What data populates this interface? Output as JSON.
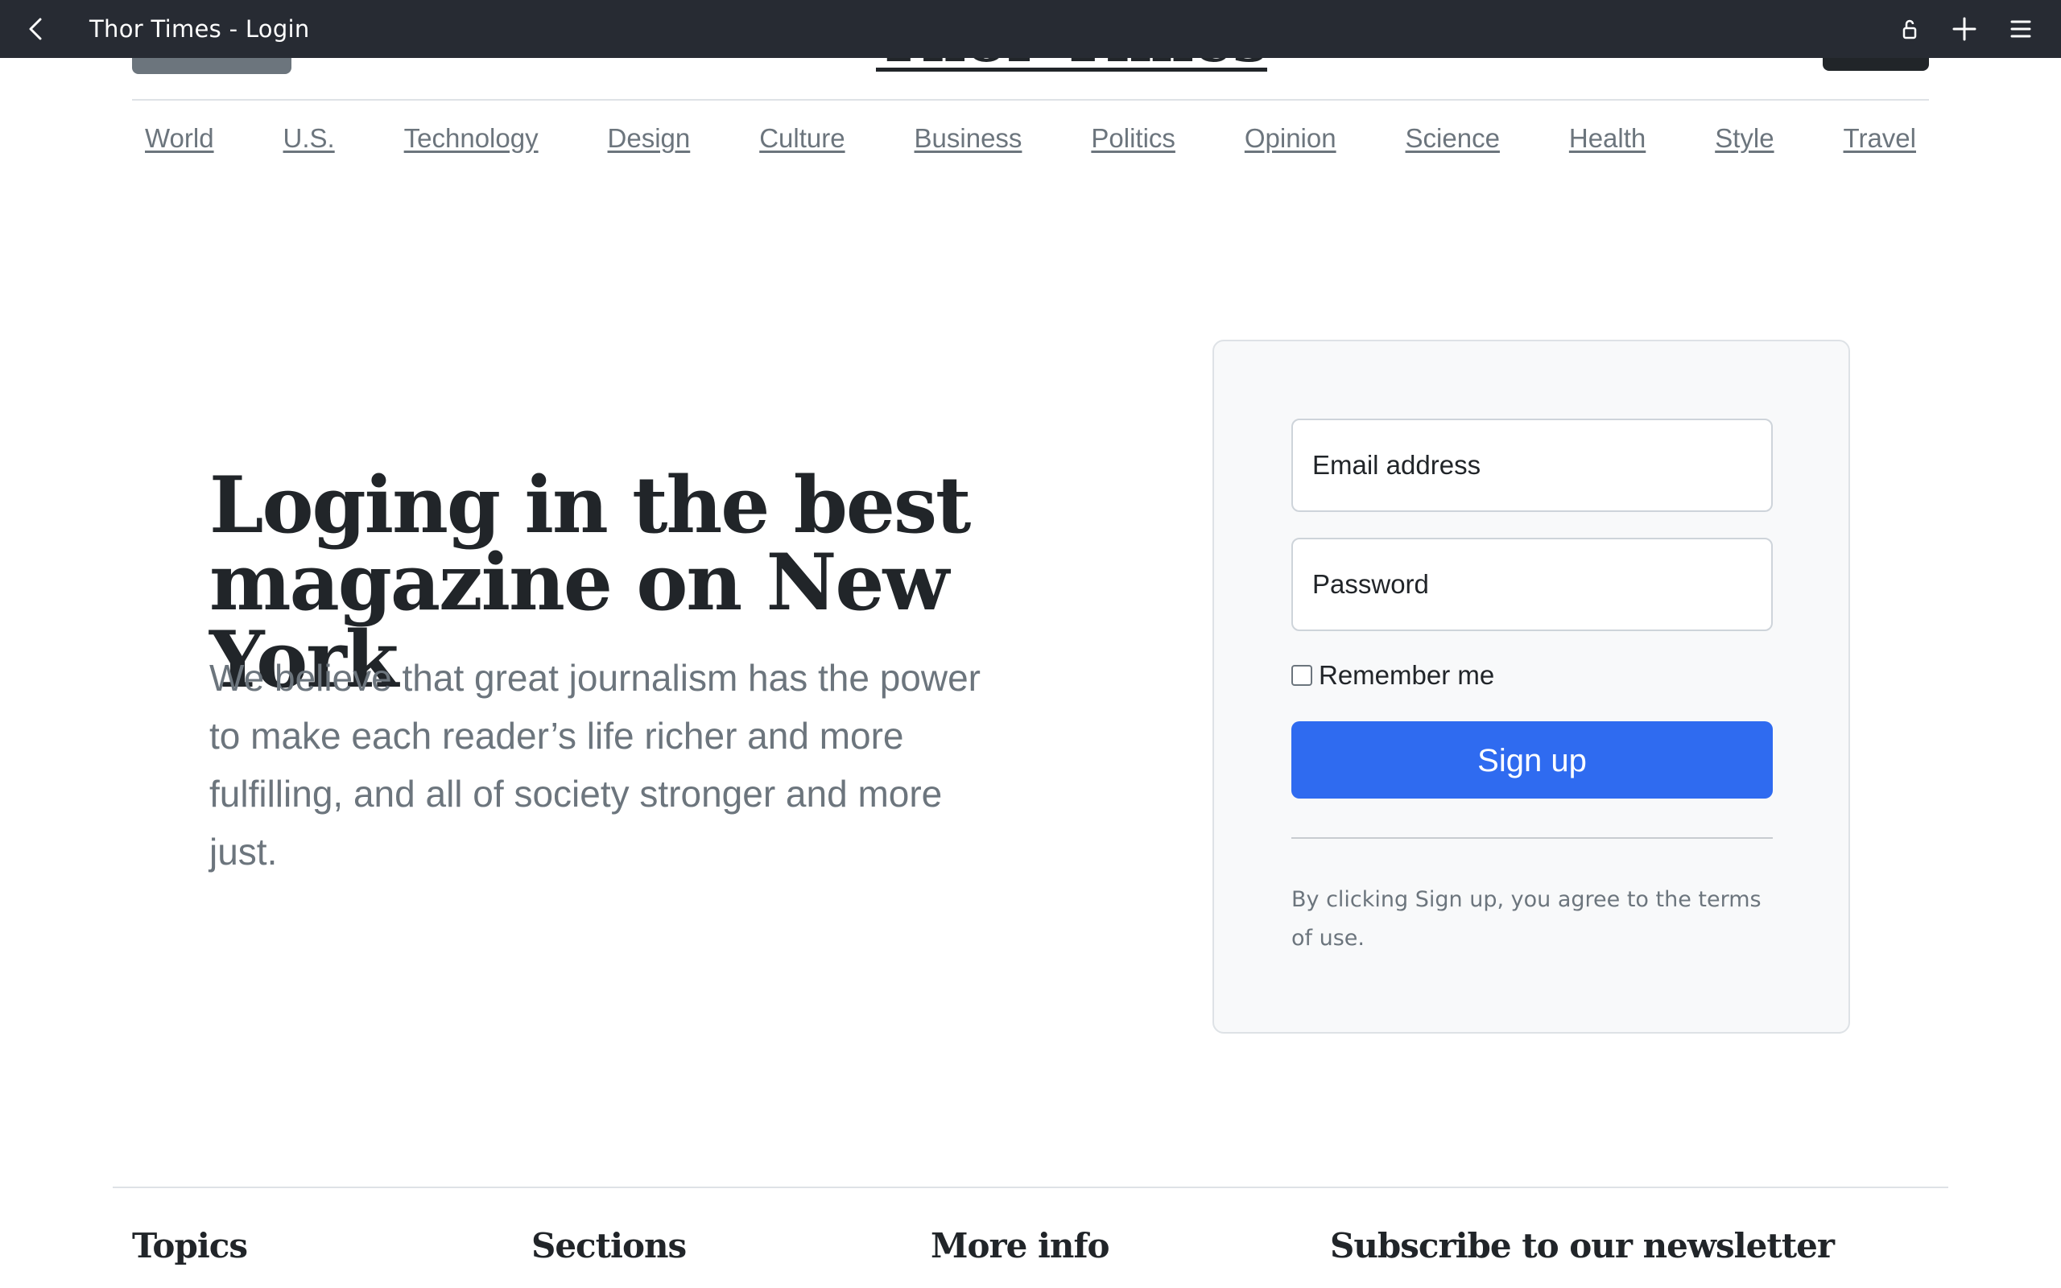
{
  "browser": {
    "title": "Thor Times - Login",
    "icons": [
      "back-icon",
      "lock-icon",
      "plus-icon",
      "menu-icon"
    ]
  },
  "masthead": {
    "title": "Thor Times"
  },
  "nav": {
    "items": [
      "World",
      "U.S.",
      "Technology",
      "Design",
      "Culture",
      "Business",
      "Politics",
      "Opinion",
      "Science",
      "Health",
      "Style",
      "Travel"
    ]
  },
  "hero": {
    "title": "Loging in the best magazine on New York",
    "text": "We believe that great journalism has the power to make each reader’s life richer and more fulfilling, and all of society stronger and more just."
  },
  "login": {
    "email_label": "Email address",
    "password_label": "Password",
    "remember_label": "Remember me",
    "remember_checked": false,
    "submit_label": "Sign up",
    "terms": "By clicking Sign up, you agree to the terms of use."
  },
  "footer": {
    "topics": "Topics",
    "sections": "Sections",
    "more_info": "More info",
    "newsletter": "Subscribe to our newsletter"
  },
  "colors": {
    "topbar": "#272b33",
    "primary": "#2f6bf0",
    "muted": "#6c757d",
    "card_bg": "#f8f9fa"
  }
}
